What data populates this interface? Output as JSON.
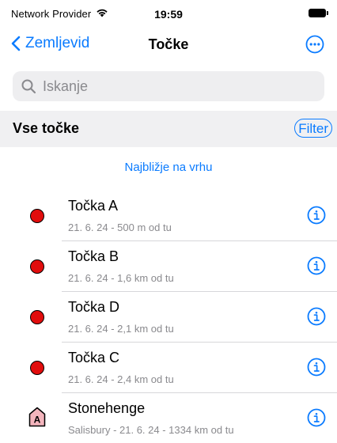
{
  "status_bar": {
    "carrier": "Network Provider",
    "time": "19:59",
    "icons": [
      "wifi-icon",
      "battery-icon"
    ]
  },
  "nav": {
    "back_label": "Zemljevid",
    "title": "Točke",
    "more_icon": "ellipsis-circle-icon"
  },
  "search": {
    "placeholder": "Iskanje",
    "value": ""
  },
  "section": {
    "title": "Vse točke",
    "filter_label": "Filter"
  },
  "sort_label": "Najbližje na vrhu",
  "colors": {
    "accent": "#0a7bff",
    "marker_red": "#e10d0d",
    "landmark_pink": "#f4b5bd",
    "section_bg": "#f0f0f2",
    "search_bg": "#eeeef0",
    "secondary_text": "#8a8a8e"
  },
  "points": [
    {
      "name": "Točka A",
      "detail": "21. 6. 24 - 500 m od tu",
      "marker": "red-dot"
    },
    {
      "name": "Točka B",
      "detail": "21. 6. 24 - 1,6 km od tu",
      "marker": "red-dot"
    },
    {
      "name": "Točka D",
      "detail": "21. 6. 24 - 2,1 km od tu",
      "marker": "red-dot"
    },
    {
      "name": "Točka C",
      "detail": "21. 6. 24 - 2,4 km od tu",
      "marker": "red-dot"
    },
    {
      "name": "Stonehenge",
      "detail": "Salisbury - 21. 6. 24 - 1334 km od tu",
      "marker": "landmark-a",
      "marker_letter": "A"
    }
  ]
}
